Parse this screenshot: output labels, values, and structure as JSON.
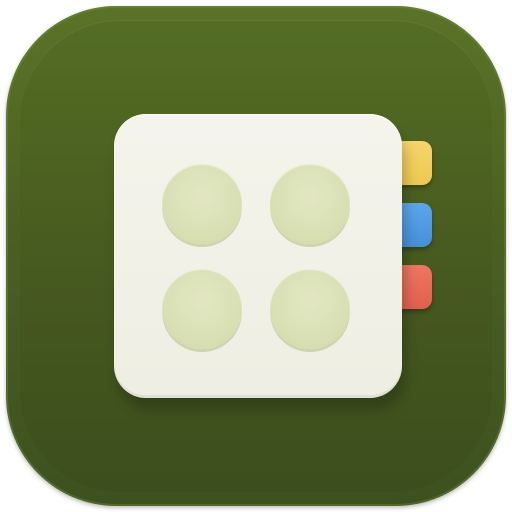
{
  "icon": {
    "name": "app-icon",
    "background_color": "#4a6022",
    "card_color": "#f0f0e6",
    "dot_color": "#d9e0b4",
    "dot_count": 4,
    "tabs": [
      {
        "name": "yellow-tab",
        "color": "#f2d15e"
      },
      {
        "name": "blue-tab",
        "color": "#4f9be1"
      },
      {
        "name": "red-tab",
        "color": "#e86b57"
      }
    ]
  }
}
